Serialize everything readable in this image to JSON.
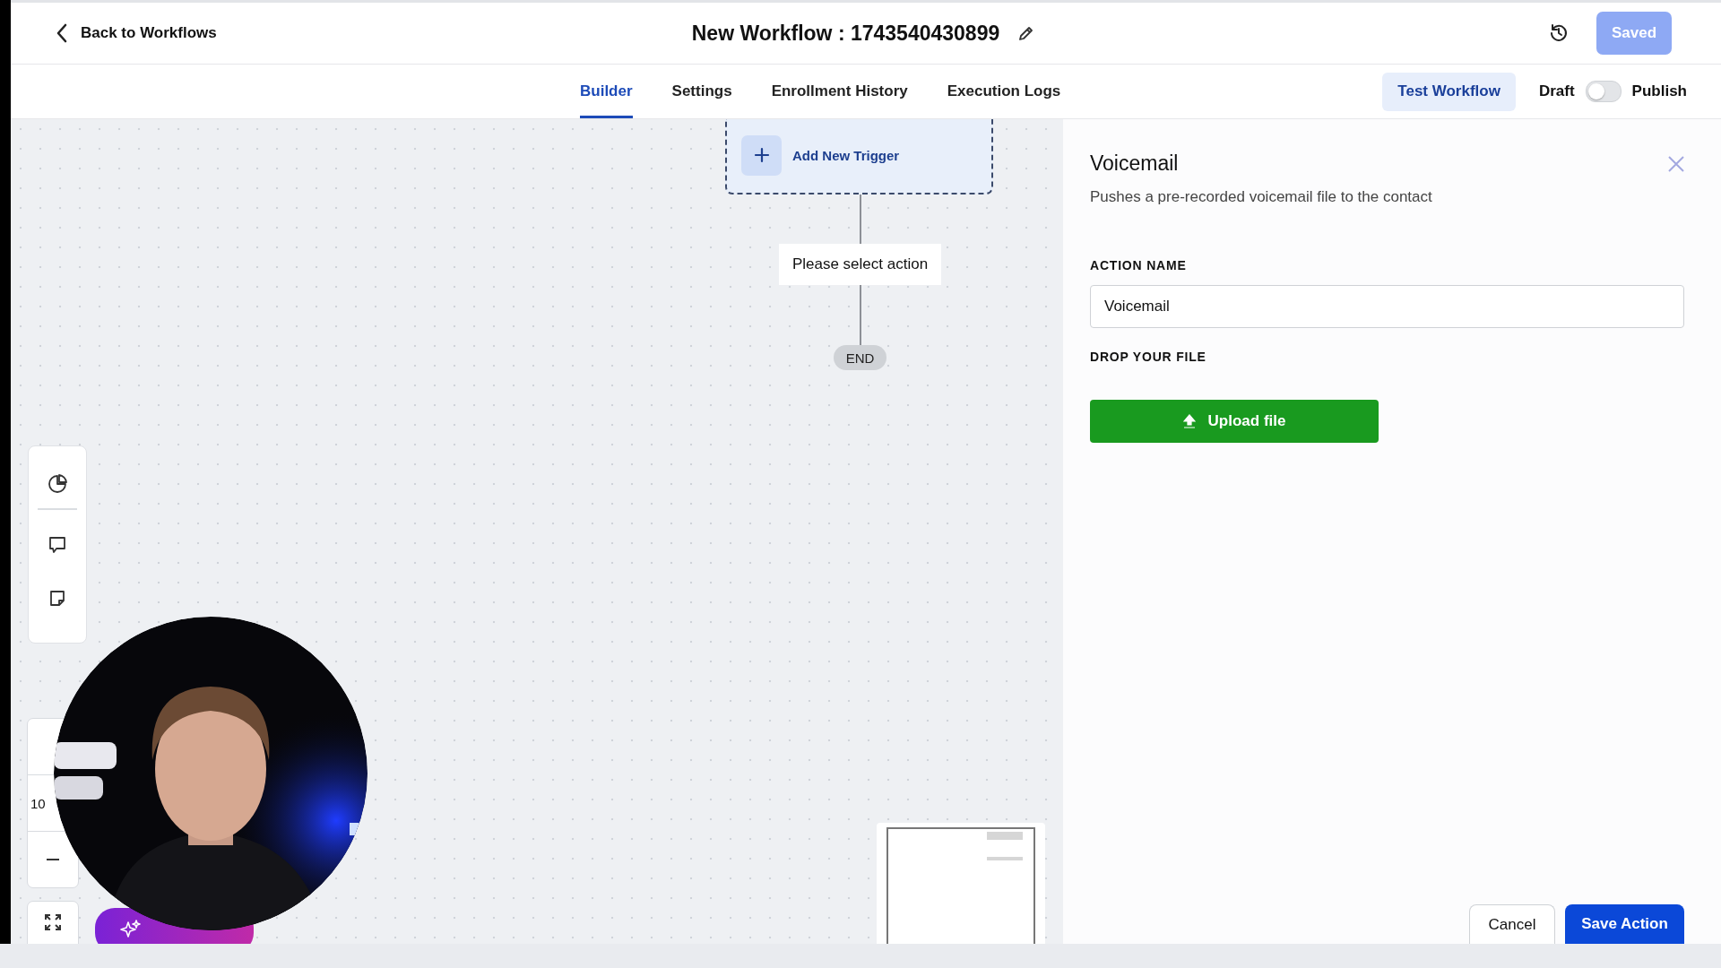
{
  "header": {
    "back_link": "Back to Workflows",
    "title": "New Workflow : 1743540430899",
    "save_button": {
      "label": "Saved",
      "disabled": true
    }
  },
  "tabs": [
    {
      "label": "Builder",
      "selected": true
    },
    {
      "label": "Settings",
      "selected": false
    },
    {
      "label": "Enrollment History",
      "selected": false
    },
    {
      "label": "Execution Logs",
      "selected": false
    }
  ],
  "test_button": "Test Workflow",
  "publish_toggle": {
    "off_label": "Draft",
    "on_label": "Publish",
    "on": false
  },
  "canvas": {
    "trigger": "Add New Trigger",
    "action_placeholder": "Please select action",
    "end": "END",
    "zoom_level": "10"
  },
  "panel": {
    "title": "Voicemail",
    "description": "Pushes a pre-recorded voicemail file to the contact",
    "fields": [
      {
        "label": "ACTION NAME",
        "kind": "text",
        "value": "Voicemail"
      },
      {
        "label": "DROP YOUR FILE",
        "kind": "upload",
        "button": "Upload file"
      }
    ],
    "buttons": [
      {
        "label": "Cancel",
        "kind": "secondary"
      },
      {
        "label": "Save Action",
        "kind": "primary"
      }
    ]
  }
}
